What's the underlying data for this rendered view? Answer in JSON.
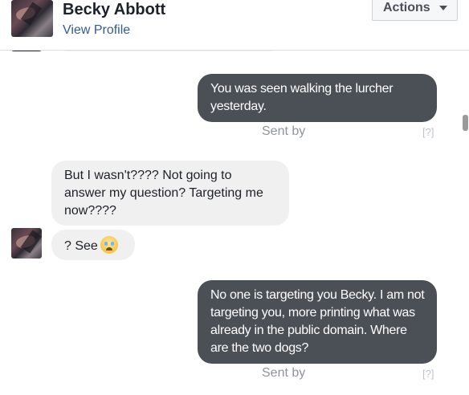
{
  "header": {
    "name": "Becky Abbott",
    "profile_link": "View Profile",
    "actions_label": "Actions"
  },
  "messages": [
    {
      "direction": "outgoing",
      "text": "You was seen walking the lurcher yesterday.",
      "status": "Sent by",
      "hint": "[?]"
    },
    {
      "direction": "incoming",
      "text": "But I wasn't???? Not going to answer my question? Targeting me now????"
    },
    {
      "direction": "incoming",
      "text": "? See",
      "emoji": "crying-face-emoji"
    },
    {
      "direction": "outgoing",
      "text": "No one is targeting you Becky. I am not targeting you, more printing what was already in the public domain. Where are the two dogs?",
      "status": "Sent by",
      "hint": "[?]"
    }
  ],
  "colors": {
    "outgoing_bubble": "#4b4f56",
    "incoming_bubble": "#f1f0f0",
    "link": "#365899",
    "meta_text": "#90949c"
  }
}
